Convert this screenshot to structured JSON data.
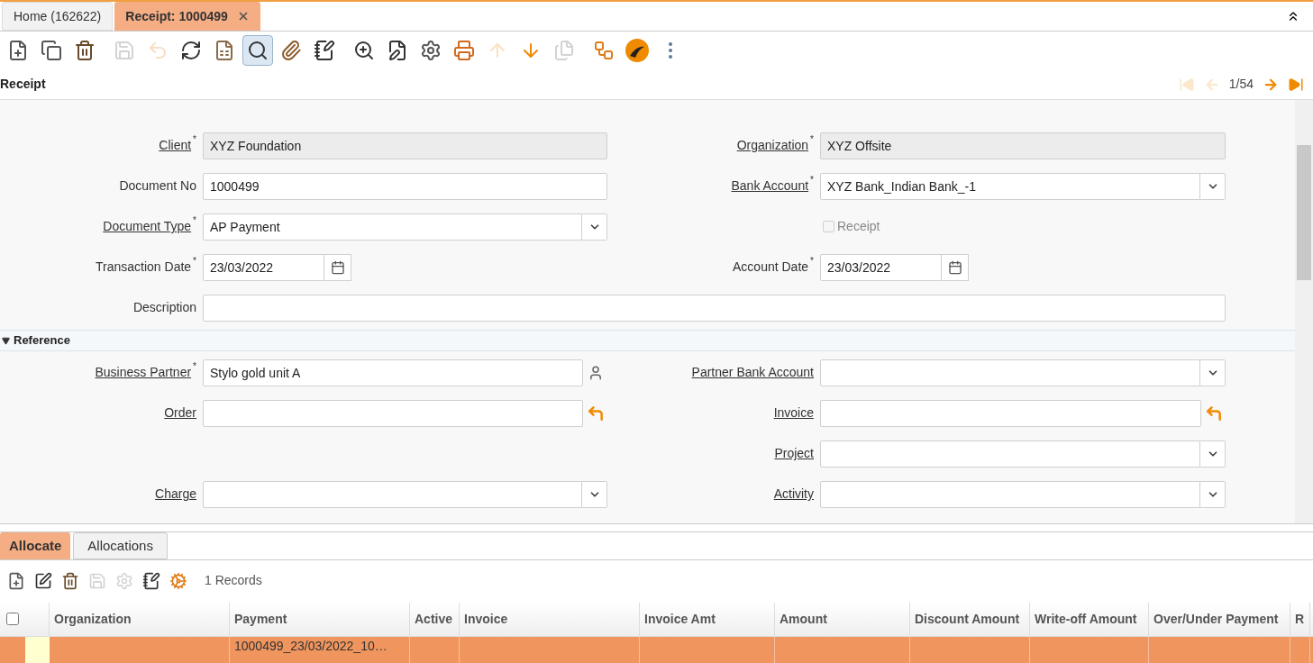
{
  "tabs": [
    {
      "label": "Home (162622)",
      "selected": false,
      "closable": false
    },
    {
      "label": "Receipt: 1000499",
      "selected": true,
      "closable": true
    }
  ],
  "toolbar": [
    {
      "kind": "new",
      "disabled": false
    },
    {
      "kind": "copy",
      "disabled": false
    },
    {
      "kind": "delete",
      "disabled": false
    },
    {
      "kind": "save",
      "disabled": true
    },
    {
      "kind": "undo",
      "disabled": true
    },
    {
      "kind": "refresh",
      "disabled": false
    },
    {
      "kind": "grid",
      "disabled": false
    },
    {
      "kind": "find",
      "disabled": false,
      "selected": true
    },
    {
      "kind": "attach",
      "disabled": false
    },
    {
      "kind": "note",
      "disabled": false
    },
    {
      "kind": "zoom",
      "disabled": false
    },
    {
      "kind": "report",
      "disabled": false
    },
    {
      "kind": "process",
      "disabled": false
    },
    {
      "kind": "print",
      "disabled": false
    },
    {
      "kind": "up",
      "disabled": true
    },
    {
      "kind": "down",
      "disabled": false
    },
    {
      "kind": "archive",
      "disabled": true
    },
    {
      "kind": "workflow",
      "disabled": false
    },
    {
      "kind": "logo",
      "disabled": false
    },
    {
      "kind": "more",
      "disabled": false
    }
  ],
  "title": "Receipt",
  "navigation": {
    "record": "1/54",
    "first_disabled": true,
    "prev_disabled": true,
    "next_disabled": false,
    "last_disabled": false
  },
  "form": {
    "rows": [
      {
        "left": {
          "label": "Client",
          "required": "*",
          "link": true,
          "kind": "text",
          "value": "XYZ Foundation",
          "readonly": true
        },
        "right": {
          "label": "Organization",
          "required": "*",
          "link": true,
          "kind": "text",
          "value": "XYZ Offsite",
          "readonly": true
        }
      },
      {
        "left": {
          "label": "Document No",
          "link": false,
          "kind": "text",
          "value": "1000499",
          "readonly": false
        },
        "right": {
          "label": "Bank Account",
          "required": "*",
          "link": true,
          "kind": "select",
          "value": "XYZ Bank_Indian Bank_-1",
          "readonly": false
        }
      },
      {
        "left": {
          "label": "Document Type",
          "required": "*",
          "link": true,
          "kind": "select",
          "value": "AP Payment",
          "readonly": false
        },
        "right": {
          "label": "Receipt",
          "kind": "checkbox",
          "checked": false,
          "disabled": true
        }
      },
      {
        "left": {
          "label": "Transaction Date",
          "required": "*",
          "link": false,
          "kind": "date",
          "value": "23/03/2022",
          "readonly": false
        },
        "right": {
          "label": "Account Date",
          "required": "*",
          "link": false,
          "kind": "date",
          "value": "23/03/2022",
          "readonly": false
        }
      },
      {
        "full": {
          "label": "Description",
          "link": false,
          "kind": "text",
          "readonly": false
        }
      }
    ],
    "section": {
      "label": "Reference",
      "expanded": true,
      "rows": [
        {
          "left": {
            "label": "Business Partner",
            "required": "*",
            "link": true,
            "kind": "partner",
            "value": "Stylo gold unit A",
            "readonly": false
          },
          "right": {
            "label": "Partner Bank Account",
            "link": true,
            "kind": "select",
            "readonly": false
          }
        },
        {
          "left": {
            "label": "Order",
            "link": true,
            "kind": "lookup",
            "readonly": false
          },
          "right": {
            "label": "Invoice",
            "link": true,
            "kind": "lookup",
            "readonly": false
          }
        },
        {
          "right": {
            "label": "Project",
            "link": true,
            "kind": "select",
            "readonly": false
          }
        },
        {
          "left": {
            "label": "Charge",
            "link": true,
            "kind": "select",
            "readonly": false
          },
          "right": {
            "label": "Activity",
            "link": true,
            "kind": "select",
            "readonly": false
          }
        }
      ]
    }
  },
  "detail_tabs": [
    {
      "label": "Allocate",
      "selected": true
    },
    {
      "label": "Allocations",
      "selected": false
    }
  ],
  "detail_toolbar": [
    {
      "kind": "new",
      "disabled": false
    },
    {
      "kind": "edit",
      "disabled": false
    },
    {
      "kind": "delete",
      "disabled": false
    },
    {
      "kind": "save",
      "disabled": true
    },
    {
      "kind": "process",
      "disabled": true
    },
    {
      "kind": "note",
      "disabled": false
    },
    {
      "kind": "customize",
      "disabled": false
    }
  ],
  "record_count": "1 Records",
  "table": {
    "all_selected": false,
    "columns": [
      "Organization",
      "Payment",
      "Active",
      "Invoice",
      "Invoice Amt",
      "Amount",
      "Discount Amount",
      "Write-off Amount",
      "Over/Under Payment",
      "R"
    ],
    "rows": [
      {
        "selected": true,
        "cells": [
          null,
          "1000499_23/03/2022_10…",
          null,
          null,
          null,
          null,
          null,
          null,
          null,
          null
        ]
      }
    ]
  }
}
